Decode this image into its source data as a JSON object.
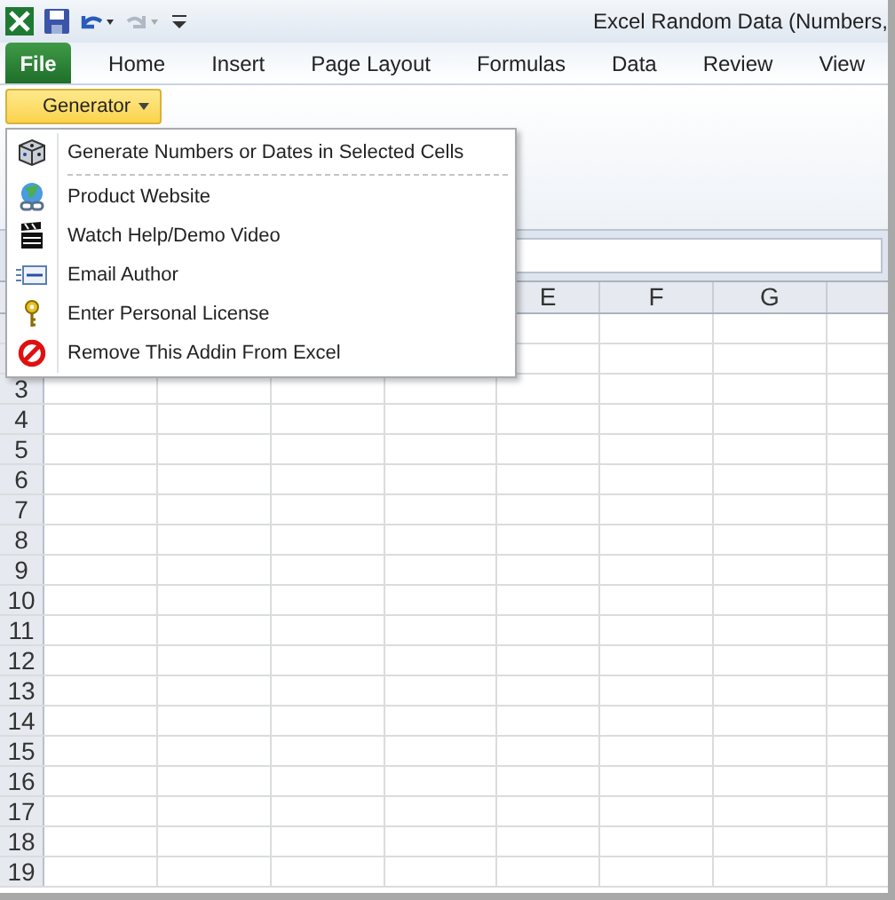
{
  "window": {
    "title": "Excel Random Data (Numbers,"
  },
  "ribbon_tabs": [
    {
      "label": "File",
      "kind": "file"
    },
    {
      "label": "Home",
      "kind": "tab"
    },
    {
      "label": "Insert",
      "kind": "tab"
    },
    {
      "label": "Page Layout",
      "kind": "tab"
    },
    {
      "label": "Formulas",
      "kind": "tab"
    },
    {
      "label": "Data",
      "kind": "tab"
    },
    {
      "label": "Review",
      "kind": "tab"
    },
    {
      "label": "View",
      "kind": "tab"
    }
  ],
  "generator_button": {
    "label": "Generator",
    "expanded": true
  },
  "menu": {
    "items": [
      {
        "label": "Generate Numbers or Dates in Selected Cells",
        "separator_after": true
      },
      {
        "label": "Product Website",
        "separator_after": false
      },
      {
        "label": "Watch Help/Demo Video",
        "separator_after": false
      },
      {
        "label": "Email Author",
        "separator_after": false
      },
      {
        "label": "Enter Personal License",
        "separator_after": false
      },
      {
        "label": "Remove This Addin From Excel",
        "separator_after": false
      }
    ]
  },
  "sheet": {
    "columns": [
      "E",
      "F",
      "G"
    ],
    "row_numbers": [
      "3",
      "4",
      "5",
      "6",
      "7",
      "8",
      "9",
      "10",
      "11",
      "12",
      "13",
      "14",
      "15",
      "16",
      "17",
      "18",
      "19"
    ]
  }
}
